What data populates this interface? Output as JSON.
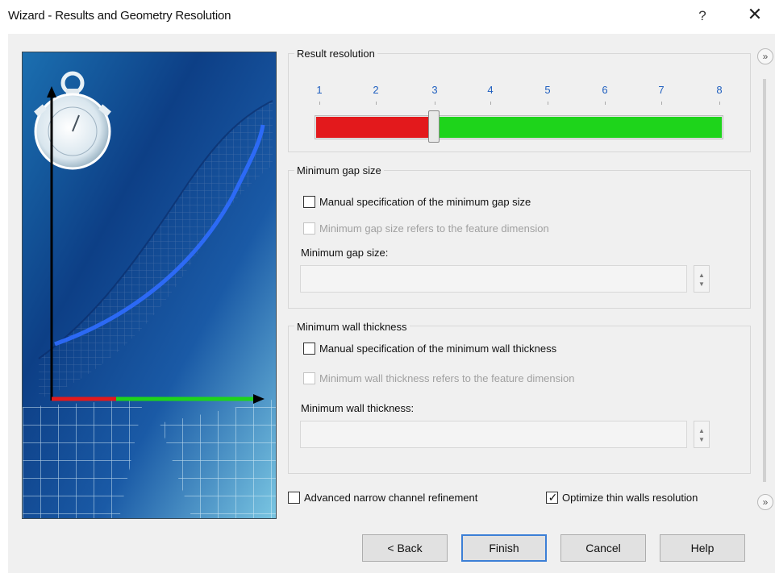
{
  "window": {
    "title": "Wizard - Results and Geometry Resolution",
    "help_glyph": "?",
    "close_glyph": "✕"
  },
  "result_resolution": {
    "label": "Result resolution",
    "ticks": [
      "1",
      "2",
      "3",
      "4",
      "5",
      "6",
      "7",
      "8"
    ],
    "value": 3,
    "min": 1,
    "max": 8,
    "colors": {
      "low": "#e3191c",
      "high": "#1ed41b"
    }
  },
  "min_gap": {
    "group_label": "Minimum gap size",
    "manual_label": "Manual specification of the minimum gap size",
    "manual_checked": false,
    "feature_label": "Minimum gap size refers to the feature dimension",
    "feature_enabled": false,
    "field_label": "Minimum gap size:",
    "field_value": ""
  },
  "min_wall": {
    "group_label": "Minimum wall thickness",
    "manual_label": "Manual specification of the minimum wall thickness",
    "manual_checked": false,
    "feature_label": "Minimum wall thickness refers to the feature dimension",
    "feature_enabled": false,
    "field_label": "Minimum wall thickness:",
    "field_value": ""
  },
  "options": {
    "advanced_label": "Advanced narrow channel refinement",
    "advanced_checked": false,
    "optimize_label": "Optimize thin walls resolution",
    "optimize_checked": true,
    "check_glyph": "✓"
  },
  "buttons": {
    "back": "< Back",
    "finish": "Finish",
    "cancel": "Cancel",
    "help": "Help"
  },
  "icons": {
    "expand": "»",
    "spin_up": "▲",
    "spin_down": "▼"
  }
}
